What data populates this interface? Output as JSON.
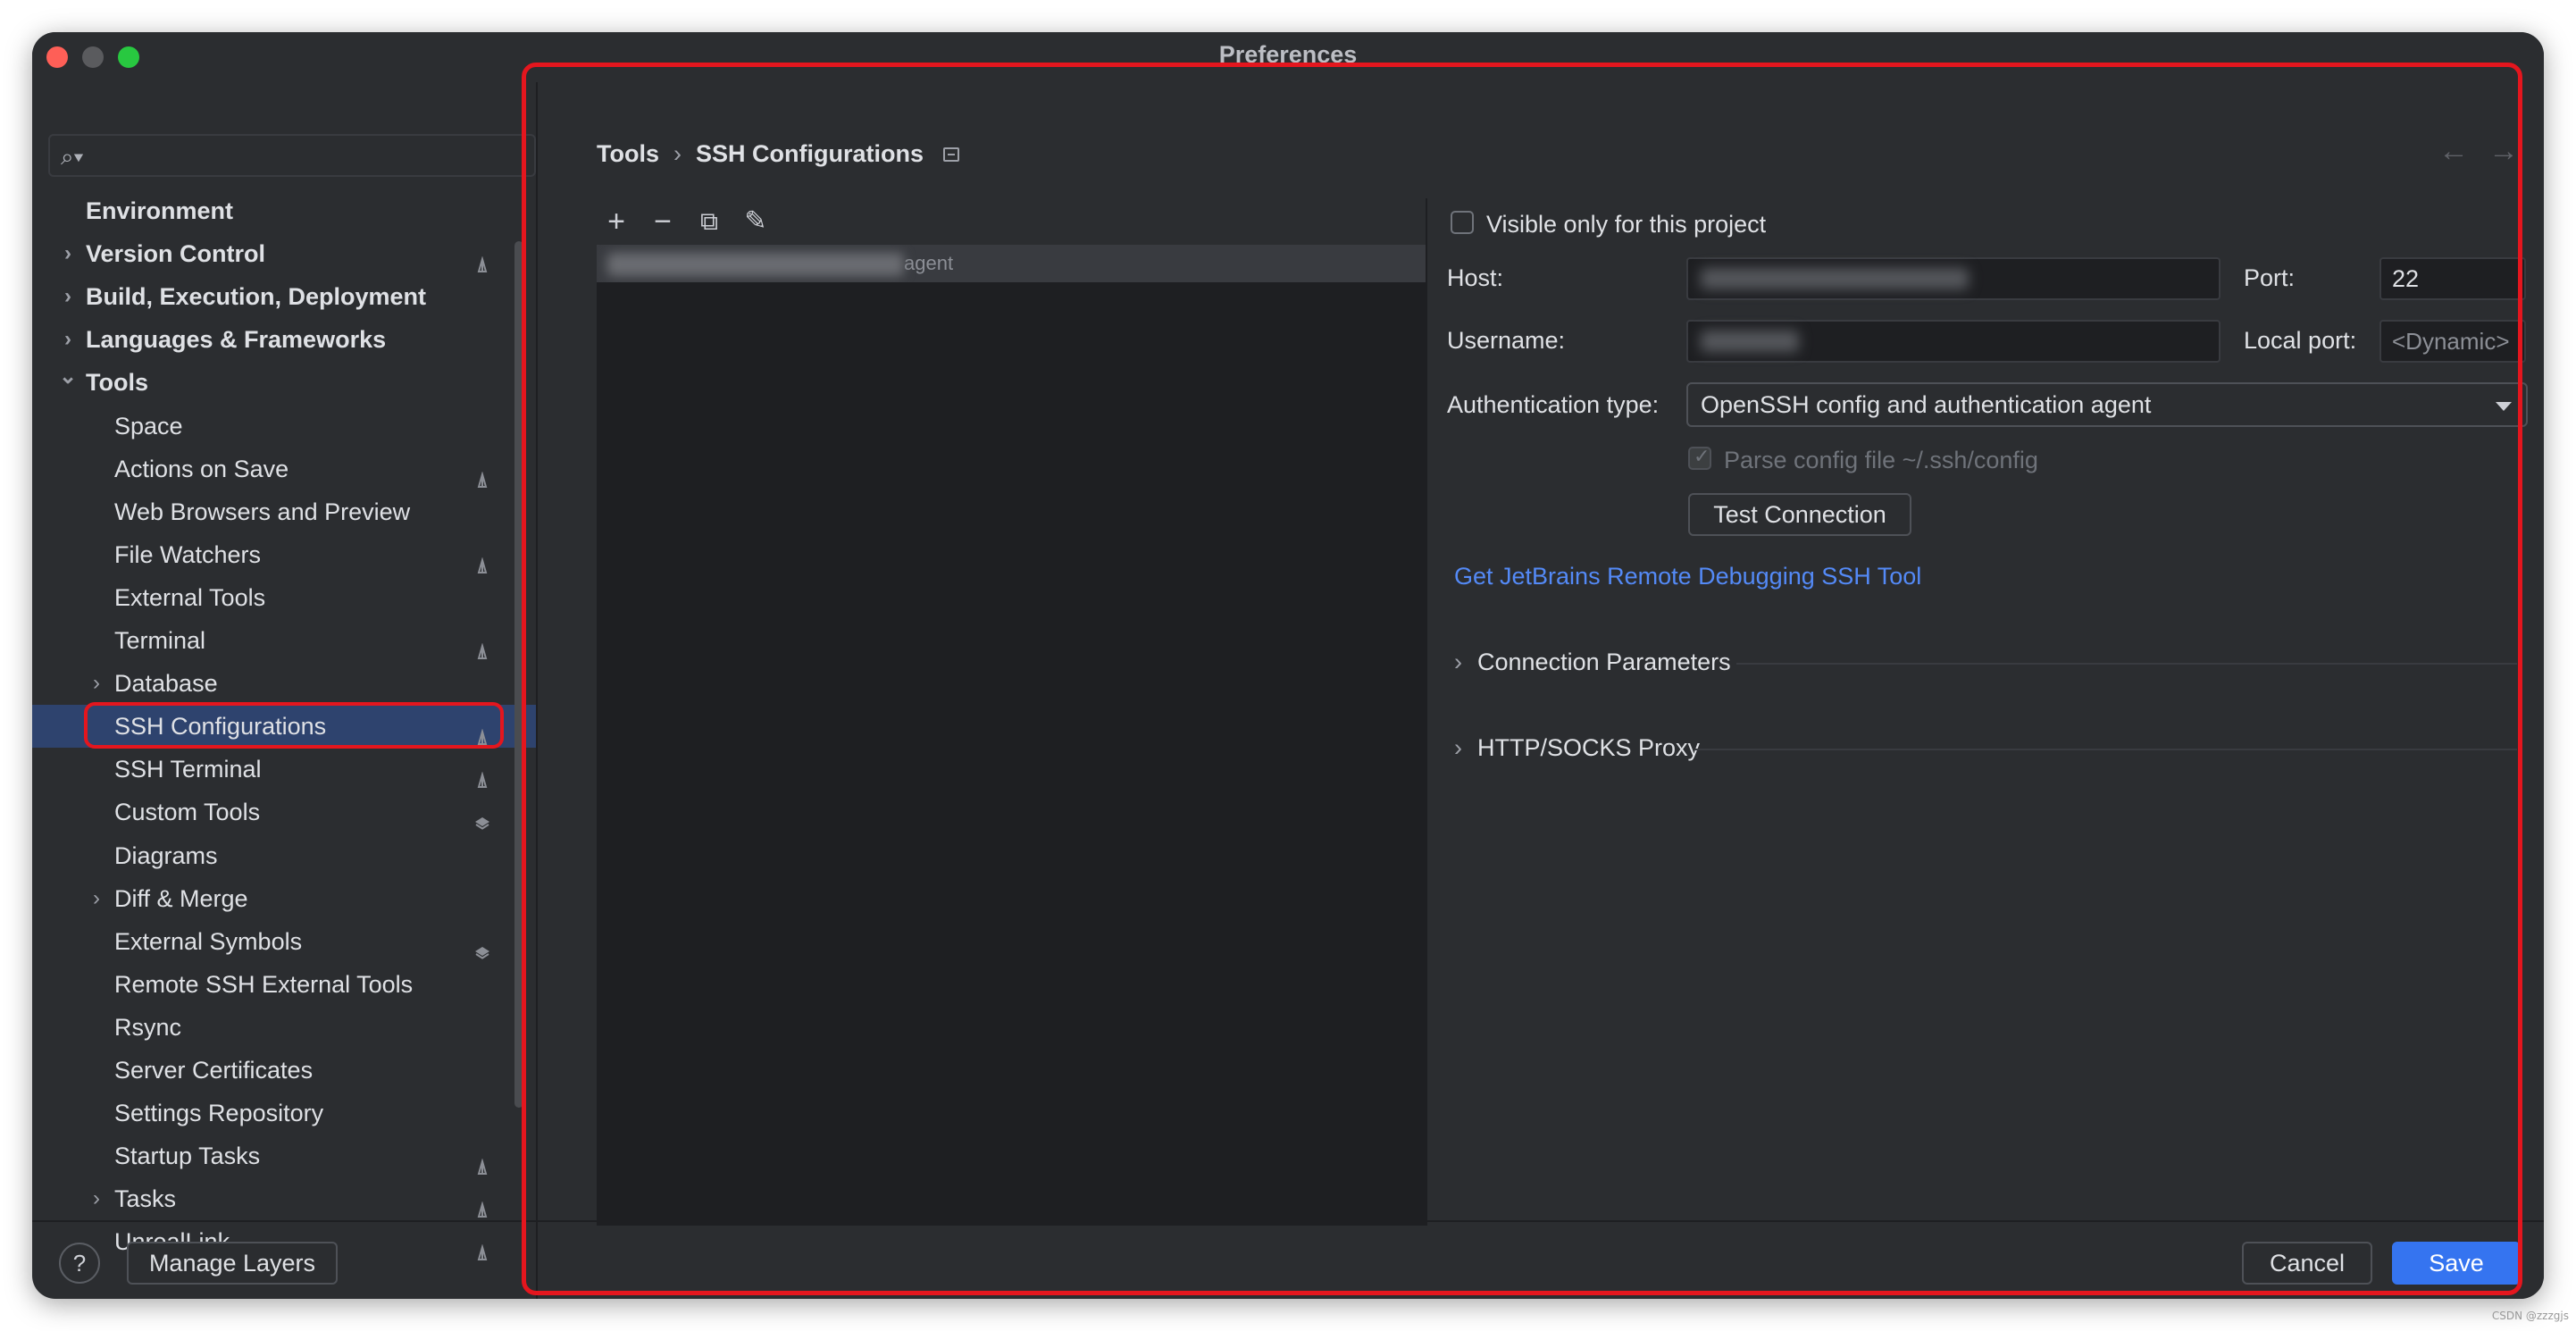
{
  "window": {
    "title": "Preferences"
  },
  "sidebar": {
    "items": [
      {
        "label": "Environment",
        "level": 0,
        "expandable": false,
        "expanded": false,
        "badge": ""
      },
      {
        "label": "Version Control",
        "level": 0,
        "expandable": true,
        "expanded": false,
        "badge": "project-icon"
      },
      {
        "label": "Build, Execution, Deployment",
        "level": 0,
        "expandable": true,
        "expanded": false,
        "badge": ""
      },
      {
        "label": "Languages & Frameworks",
        "level": 0,
        "expandable": true,
        "expanded": false,
        "badge": ""
      },
      {
        "label": "Tools",
        "level": 0,
        "expandable": true,
        "expanded": true,
        "badge": ""
      },
      {
        "label": "Space",
        "level": 1,
        "expandable": false,
        "expanded": false,
        "badge": ""
      },
      {
        "label": "Actions on Save",
        "level": 1,
        "expandable": false,
        "expanded": false,
        "badge": "project-icon"
      },
      {
        "label": "Web Browsers and Preview",
        "level": 1,
        "expandable": false,
        "expanded": false,
        "badge": ""
      },
      {
        "label": "File Watchers",
        "level": 1,
        "expandable": false,
        "expanded": false,
        "badge": "project-icon"
      },
      {
        "label": "External Tools",
        "level": 1,
        "expandable": false,
        "expanded": false,
        "badge": ""
      },
      {
        "label": "Terminal",
        "level": 1,
        "expandable": false,
        "expanded": false,
        "badge": "project-icon"
      },
      {
        "label": "Database",
        "level": 1,
        "expandable": true,
        "expanded": false,
        "badge": ""
      },
      {
        "label": "SSH Configurations",
        "level": 1,
        "expandable": false,
        "expanded": false,
        "badge": "project-icon",
        "selected": true
      },
      {
        "label": "SSH Terminal",
        "level": 1,
        "expandable": false,
        "expanded": false,
        "badge": "project-icon"
      },
      {
        "label": "Custom Tools",
        "level": 1,
        "expandable": false,
        "expanded": false,
        "badge": "layers-icon"
      },
      {
        "label": "Diagrams",
        "level": 1,
        "expandable": false,
        "expanded": false,
        "badge": ""
      },
      {
        "label": "Diff & Merge",
        "level": 1,
        "expandable": true,
        "expanded": false,
        "badge": ""
      },
      {
        "label": "External Symbols",
        "level": 1,
        "expandable": false,
        "expanded": false,
        "badge": "layers-icon"
      },
      {
        "label": "Remote SSH External Tools",
        "level": 1,
        "expandable": false,
        "expanded": false,
        "badge": ""
      },
      {
        "label": "Rsync",
        "level": 1,
        "expandable": false,
        "expanded": false,
        "badge": ""
      },
      {
        "label": "Server Certificates",
        "level": 1,
        "expandable": false,
        "expanded": false,
        "badge": ""
      },
      {
        "label": "Settings Repository",
        "level": 1,
        "expandable": false,
        "expanded": false,
        "badge": ""
      },
      {
        "label": "Startup Tasks",
        "level": 1,
        "expandable": false,
        "expanded": false,
        "badge": "project-icon"
      },
      {
        "label": "Tasks",
        "level": 1,
        "expandable": true,
        "expanded": false,
        "badge": "project-icon"
      },
      {
        "label": "UnrealLink",
        "level": 1,
        "expandable": false,
        "expanded": false,
        "badge": "project-icon"
      }
    ]
  },
  "breadcrumb": {
    "parent": "Tools",
    "separator": "›",
    "current": "SSH Configurations"
  },
  "nav": {
    "back": "←",
    "forward": "→"
  },
  "list_toolbar": {
    "add": "+",
    "remove": "−",
    "copy": "⧉",
    "edit": "✎"
  },
  "list": {
    "row_suffix": "agent"
  },
  "form": {
    "visible_only_label": "Visible only for this project",
    "visible_only_checked": false,
    "host_label": "Host:",
    "port_label": "Port:",
    "port_value": "22",
    "username_label": "Username:",
    "local_port_label": "Local port:",
    "local_port_placeholder": "<Dynamic>",
    "auth_type_label": "Authentication type:",
    "auth_type_value": "OpenSSH config and authentication agent",
    "parse_config_label": "Parse config file ~/.ssh/config",
    "parse_config_checked": true,
    "test_connection_label": "Test Connection",
    "remote_debug_link": "Get JetBrains Remote Debugging SSH Tool",
    "connection_params_label": "Connection Parameters",
    "proxy_label": "HTTP/SOCKS Proxy"
  },
  "footer": {
    "help_label": "?",
    "manage_layers_label": "Manage Layers",
    "cancel_label": "Cancel",
    "save_label": "Save"
  },
  "watermark": "CSDN @zzzgjs",
  "colors": {
    "window_bg": "#2b2d30",
    "selection": "#2e436e",
    "accent": "#3574f0",
    "link": "#548af7",
    "annotation_red": "#e4161e"
  }
}
